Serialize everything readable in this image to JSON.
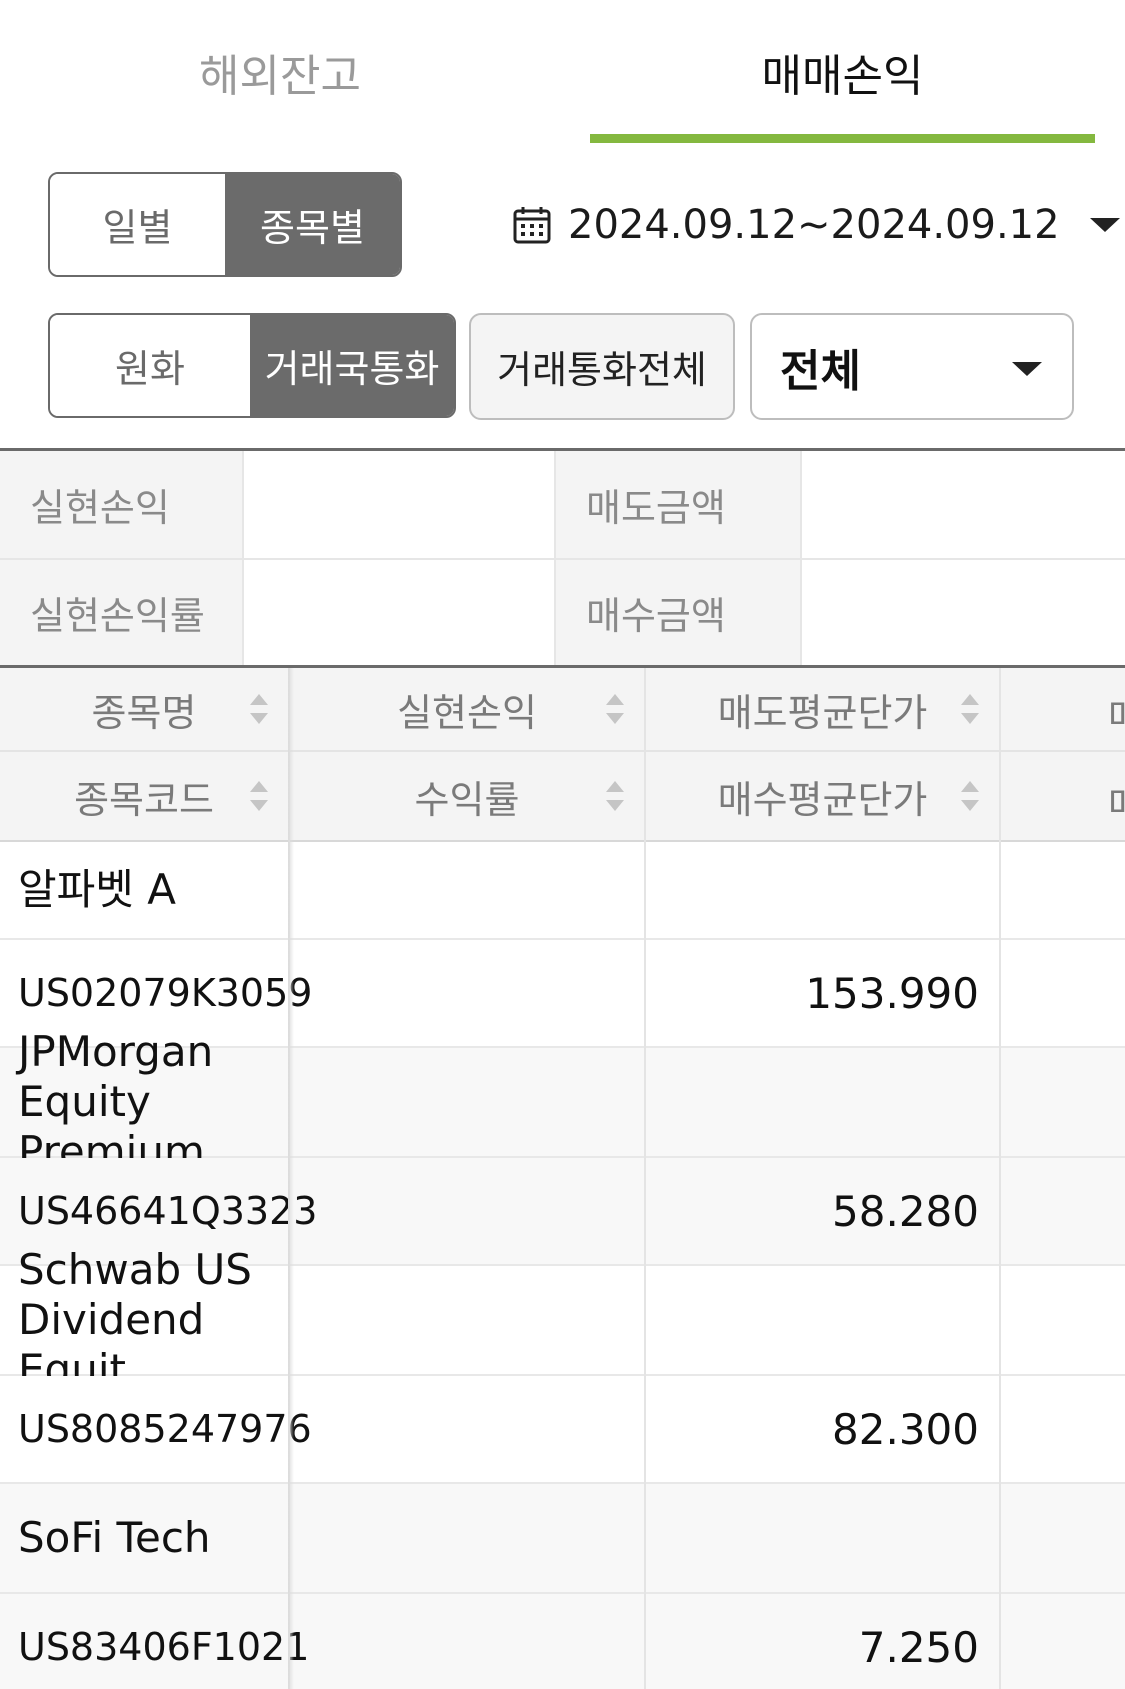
{
  "tabs": {
    "left": "해외잔고",
    "right": "매매손익"
  },
  "view_toggle": {
    "daily": "일별",
    "by_item": "종목별"
  },
  "date_range": "2024.09.12~2024.09.12",
  "currency_toggle": {
    "krw": "원화",
    "trade_currency": "거래국통화"
  },
  "all_currency_button": "거래통화전체",
  "filter_select": "전체",
  "summary": {
    "realized_pl": "실현손익",
    "sell_amount": "매도금액",
    "realized_pl_rate": "실현손익률",
    "buy_amount": "매수금액"
  },
  "columns": {
    "name": "종목명",
    "code": "종목코드",
    "realized_pl": "실현손익",
    "return_rate": "수익률",
    "avg_sell_price": "매도평균단가",
    "avg_buy_price": "매수평균단가",
    "cut_top": "매",
    "cut_bottom": "매"
  },
  "rows": [
    {
      "name": "알파벳 A",
      "code": "US02079K3059",
      "avg_buy_price": "153.990"
    },
    {
      "name": "JPMorgan Equity Premium",
      "code": "US46641Q3323",
      "avg_buy_price": "58.280"
    },
    {
      "name": "Schwab US Dividend Equit",
      "code": "US8085247976",
      "avg_buy_price": "82.300"
    },
    {
      "name": "SoFi Tech",
      "code": "US83406F1021",
      "avg_buy_price": "7.250"
    }
  ]
}
